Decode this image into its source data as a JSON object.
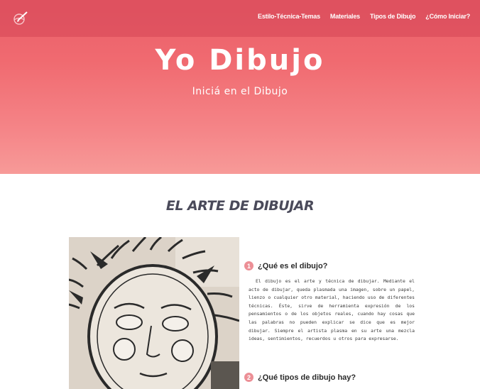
{
  "nav": {
    "items": [
      "Estilo-Técnica-Temas",
      "Materiales",
      "Tipos de Dibujo",
      "¿Cómo Iniciar?"
    ]
  },
  "hero": {
    "title": "Yo Dibujo",
    "subtitle": "Iniciá en el Dibujo"
  },
  "main": {
    "section_title": "EL ARTE DE DIBUJAR",
    "questions": [
      {
        "number": "1",
        "title": "¿Qué es el dibujo?",
        "text": "El dibujo es el arte y técnica de dibujar. Mediante el acto de dibujar, queda plasmada una imagen, sobre un papel, lienzo o cualquier otro material, haciendo uso de diferentes técnicas. Éste, sirve de herramienta expresión de los pensamientos o de los objetos reales, cuando hay cosas que las palabras no pueden explicar se dice que es mejor dibujar. Siempre el artista plasma en su arte una mezcla ideas, sentimientos, recuerdos u otros para expresarse."
      },
      {
        "number": "2",
        "title": "¿Qué tipos de dibujo hay?"
      }
    ]
  },
  "colors": {
    "hero_top": "#ea5f6b",
    "hero_bottom": "#f79a98",
    "badge": "#ec8f96",
    "section_title": "#4a4a5a"
  },
  "icons": {
    "logo": "pencil-drawing-icon",
    "photo": "sun-face-drawing"
  }
}
